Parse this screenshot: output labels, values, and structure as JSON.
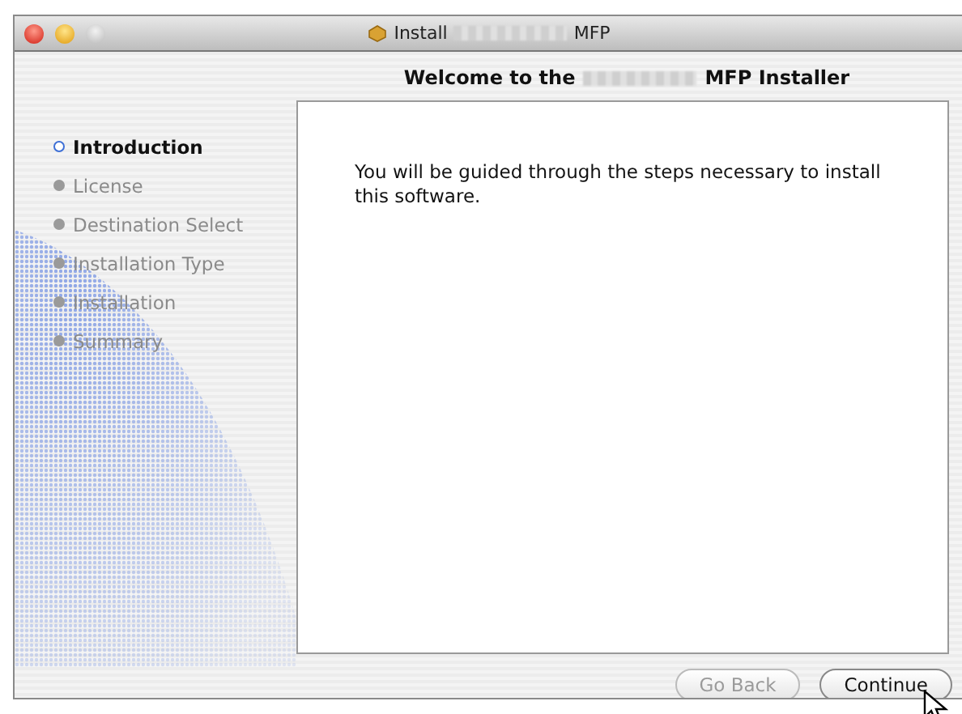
{
  "window": {
    "title_start": "Install",
    "title_end": "MFP"
  },
  "heading": {
    "start": "Welcome to the",
    "end": "MFP Installer"
  },
  "steps": [
    {
      "label": "Introduction",
      "selected": true
    },
    {
      "label": "License",
      "selected": false
    },
    {
      "label": "Destination Select",
      "selected": false
    },
    {
      "label": "Installation Type",
      "selected": false
    },
    {
      "label": "Installation",
      "selected": false
    },
    {
      "label": "Summary",
      "selected": false
    }
  ],
  "body": "You will be guided through the steps necessary to install this software.",
  "buttons": [
    {
      "label": "Go Back",
      "disabled": true
    },
    {
      "label": "Continue",
      "disabled": false
    }
  ]
}
